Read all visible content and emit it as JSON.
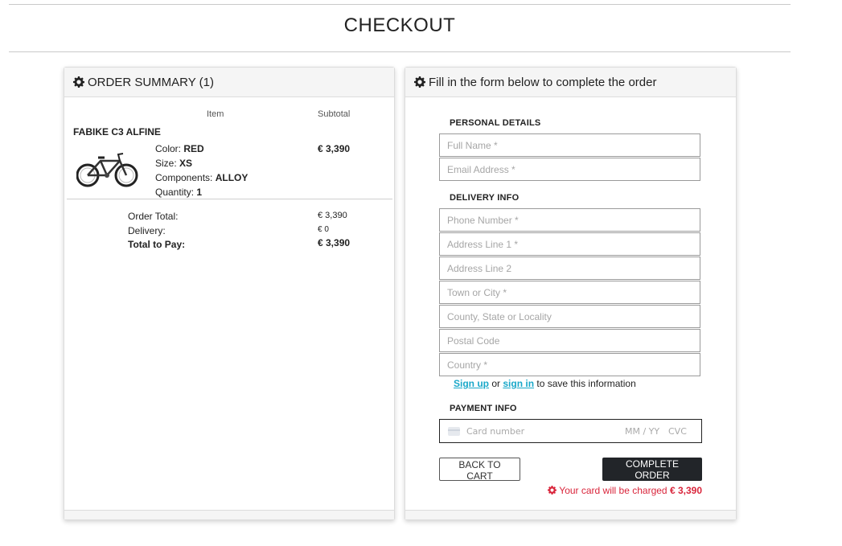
{
  "page": {
    "title": "CHECKOUT"
  },
  "summary": {
    "header": "ORDER SUMMARY (1)",
    "col_item": "Item",
    "col_subtotal": "Subtotal",
    "product": {
      "name": "FABIKE C3 ALFINE",
      "color_label": "Color:",
      "color_value": "RED",
      "size_label": "Size:",
      "size_value": "XS",
      "components_label": "Components:",
      "components_value": "ALLOY",
      "quantity_label": "Quantity:",
      "quantity_value": "1",
      "subtotal": "€ 3,390"
    },
    "order_total_label": "Order Total:",
    "order_total_value": "€ 3,390",
    "delivery_label": "Delivery:",
    "delivery_value": "€ 0",
    "total_label": "Total to Pay:",
    "total_value": "€ 3,390"
  },
  "form": {
    "header": "Fill in the form below to complete the order",
    "personal_title": "PERSONAL DETAILS",
    "full_name_ph": "Full Name *",
    "email_ph": "Email Address *",
    "delivery_title": "DELIVERY INFO",
    "phone_ph": "Phone Number *",
    "address1_ph": "Address Line 1 *",
    "address2_ph": "Address Line 2",
    "town_ph": "Town or City *",
    "county_ph": "County, State or Locality",
    "postal_ph": "Postal Code",
    "country_ph": "Country *",
    "signup_link": "Sign up",
    "or_text": "or",
    "signin_link": "sign in",
    "save_text": "to save this information",
    "payment_title": "PAYMENT INFO",
    "card_number_ph": "Card number",
    "card_expiry_ph": "MM / YY",
    "card_cvc_ph": "CVC",
    "back_button": "BACK TO CART",
    "complete_button": "COMPLETE ORDER",
    "charge_text": "Your card will be charged",
    "charge_amount": "€ 3,390"
  },
  "icons": {
    "header_icon": "gear-icon",
    "product_image": "bicycle",
    "card_brand": "credit-card-icon"
  },
  "colors": {
    "link": "#1aa8c9",
    "warning": "#d9253b",
    "primary_button": "#222529"
  }
}
